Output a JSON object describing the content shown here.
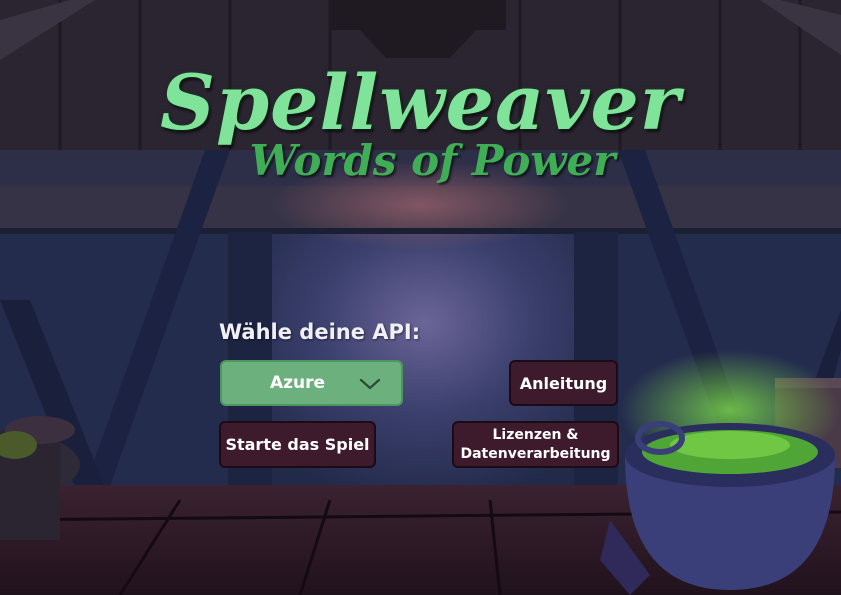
{
  "title": {
    "main": "Spellweaver",
    "sub": "Words of Power"
  },
  "menu": {
    "api_label": "Wähle deine API:",
    "api_selected": "Azure",
    "start_label": "Starte das Spiel",
    "guide_label": "Anleitung",
    "license_label_line1": "Lizenzen &",
    "license_label_line2": "Datenverarbeitung"
  },
  "colors": {
    "title_main": "#7fe39a",
    "title_sub": "#3fae56",
    "select_bg": "#6cb07e",
    "button_bg": "#3e1b2c",
    "cauldron_glow": "#6fd83a"
  },
  "icons": {
    "select_arrow": "chevron-down-icon"
  }
}
